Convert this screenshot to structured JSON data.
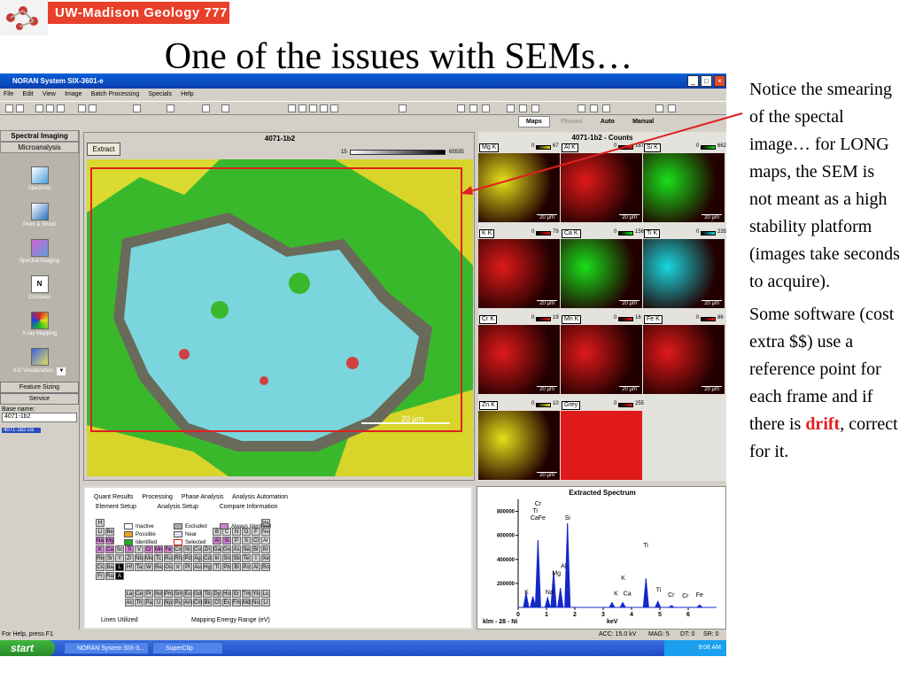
{
  "slide": {
    "course_label": "UW-Madison Geology  777",
    "title": "One of the issues with SEMs…",
    "note1": "Notice the smearing of the spectal image… for LONG maps, the SEM is not meant as a high stability platform (images take seconds to acquire).",
    "note2_a": "Some software (cost extra $$) use a reference point for each frame and if there is ",
    "note2_drift": "drift",
    "note2_b": ", correct for it."
  },
  "window": {
    "title": "NORAN System SIX-3601-e",
    "menu": [
      "File",
      "Edit",
      "View",
      "Image",
      "Batch Processing",
      "Specials",
      "Help"
    ],
    "tabs": [
      "Maps",
      "Phases",
      "Auto",
      "Manual"
    ]
  },
  "sidebar": {
    "header": "Spectral Imaging",
    "subheader": "Microanalysis",
    "items": [
      "Spectrum",
      "Point & Shoot",
      "Spectral Imaging",
      "Compass",
      "X-ray Mapping",
      "3-D Visualization"
    ],
    "buttons": [
      "Feature Sizing",
      "Service"
    ],
    "base_name_label": "Base name:",
    "base_name_value": "4071-1b2",
    "file_entry": "4071-1b2.csi"
  },
  "spectral_image": {
    "title": "4071-1b2",
    "extract_label": "Extract",
    "scale_min": "15",
    "scale_max": "65535",
    "scalebar_label": "20 µm"
  },
  "element_maps": {
    "title": "4071-1b2 - Counts",
    "scalebar_label": "20 µm",
    "tiles": [
      {
        "label": "Mg K",
        "min": "0",
        "max": "67",
        "color": "#e6e01a"
      },
      {
        "label": "Al K",
        "min": "0",
        "max": "187",
        "color": "#e01a1a"
      },
      {
        "label": "Si K",
        "min": "0",
        "max": "662",
        "color": "#1ae01a"
      },
      {
        "label": "K K",
        "min": "0",
        "max": "79",
        "color": "#e01a1a"
      },
      {
        "label": "Ca K",
        "min": "0",
        "max": "156",
        "color": "#1ae01a"
      },
      {
        "label": "Ti K",
        "min": "0",
        "max": "235",
        "color": "#1ad8e0"
      },
      {
        "label": "Cr K",
        "min": "0",
        "max": "19",
        "color": "#e01a1a"
      },
      {
        "label": "Mn K",
        "min": "0",
        "max": "16",
        "color": "#e01a1a"
      },
      {
        "label": "Fe K",
        "min": "0",
        "max": "86",
        "color": "#e01a1a"
      },
      {
        "label": "Zn K",
        "min": "0",
        "max": "10",
        "color": "#e6e01a"
      },
      {
        "label": "Grey",
        "min": "0",
        "max": "255",
        "color": "#e01a1a"
      }
    ]
  },
  "periodic_panel": {
    "tabs_row1": [
      "Quant Results",
      "Processing",
      "Phase Analysis",
      "Analysis Automation"
    ],
    "tabs_row2": [
      "Element Setup",
      "Analysis Setup",
      "Compare Information"
    ],
    "legend": [
      "Inactive",
      "Possible",
      "Identified",
      "Excluded",
      "Near",
      "Selected",
      "Always Identified"
    ],
    "lines_label": "Lines Utilized",
    "mapping_label": "Mapping Energy Range (eV)"
  },
  "spectrum": {
    "title": "Extracted Spectrum",
    "footer_left": "klm - 28 - Ni",
    "xlabel": "keV"
  },
  "chart_data": {
    "type": "line",
    "title": "Extracted Spectrum",
    "xlabel": "keV",
    "ylabel": "",
    "xlim": [
      0,
      7
    ],
    "ylim": [
      0,
      900000
    ],
    "yticks": [
      200000,
      400000,
      600000,
      800000
    ],
    "xticks": [
      0,
      1,
      2,
      3,
      4,
      5,
      6
    ],
    "peaks": [
      {
        "x": 0.28,
        "y": 120000
      },
      {
        "x": 0.52,
        "y": 90000
      },
      {
        "x": 0.7,
        "y": 560000
      },
      {
        "x": 1.04,
        "y": 80000
      },
      {
        "x": 1.25,
        "y": 300000
      },
      {
        "x": 1.49,
        "y": 160000
      },
      {
        "x": 1.74,
        "y": 700000
      },
      {
        "x": 3.31,
        "y": 40000
      },
      {
        "x": 3.69,
        "y": 40000
      },
      {
        "x": 4.51,
        "y": 240000
      },
      {
        "x": 4.93,
        "y": 50000
      },
      {
        "x": 5.41,
        "y": 15000
      },
      {
        "x": 6.4,
        "y": 20000
      }
    ],
    "labels": [
      {
        "x": 0.7,
        "y": 850000,
        "text": "Cr"
      },
      {
        "x": 0.6,
        "y": 790000,
        "text": "Ti"
      },
      {
        "x": 0.7,
        "y": 730000,
        "text": "CaFe"
      },
      {
        "x": 1.74,
        "y": 730000,
        "text": "Si"
      },
      {
        "x": 1.6,
        "y": 330000,
        "text": "Al"
      },
      {
        "x": 1.35,
        "y": 270000,
        "text": "Mg"
      },
      {
        "x": 1.1,
        "y": 110000,
        "text": "Na"
      },
      {
        "x": 0.3,
        "y": 110000,
        "text": "K"
      },
      {
        "x": 4.5,
        "y": 500000,
        "text": "Ti"
      },
      {
        "x": 3.7,
        "y": 230000,
        "text": "K"
      },
      {
        "x": 3.45,
        "y": 100000,
        "text": "K"
      },
      {
        "x": 3.85,
        "y": 100000,
        "text": "Ca"
      },
      {
        "x": 4.95,
        "y": 130000,
        "text": "Ti"
      },
      {
        "x": 5.4,
        "y": 90000,
        "text": "Cr"
      },
      {
        "x": 5.9,
        "y": 80000,
        "text": "Cr"
      },
      {
        "x": 6.4,
        "y": 90000,
        "text": "Fe"
      }
    ]
  },
  "status": {
    "left": "For Help, press F1",
    "acc": "ACC: 15.0 kV",
    "mag": "MAG: 5",
    "dt": "DT: 0",
    "sr": "SR: 0"
  },
  "taskbar": {
    "start": "start",
    "tasks": [
      "NORAN System SIX-3...",
      "SuperClip"
    ],
    "clock": "9:08 AM"
  },
  "colors": {
    "accent": "#e8402a",
    "drift": "#e02020",
    "taskbar": "#2a5fd6"
  }
}
